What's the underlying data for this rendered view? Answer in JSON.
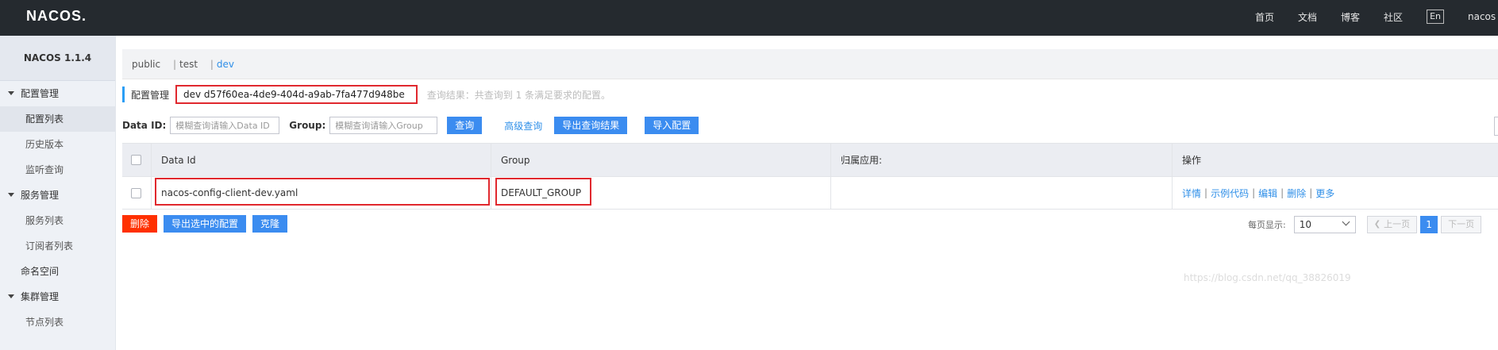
{
  "topbar": {
    "logo": "NACOS.",
    "nav": [
      "首页",
      "文档",
      "博客",
      "社区"
    ],
    "lang": "En",
    "user": "nacos"
  },
  "sidebar": {
    "version": "NACOS 1.1.4",
    "groups": [
      {
        "label": "配置管理",
        "items": [
          "配置列表",
          "历史版本",
          "监听查询"
        ]
      },
      {
        "label": "服务管理",
        "items": [
          "服务列表",
          "订阅者列表"
        ]
      }
    ],
    "namespace_label": "命名空间",
    "cluster": {
      "label": "集群管理",
      "items": [
        "节点列表"
      ]
    }
  },
  "namespaces": {
    "items": [
      "public",
      "test",
      "dev"
    ],
    "active": "dev",
    "separator": "|"
  },
  "page": {
    "title": "配置管理",
    "namespace_id": "dev  d57f60ea-4de9-404d-a9ab-7fa477d948be",
    "query_result": "查询结果：共查询到 1 条满足要求的配置。"
  },
  "filters": {
    "data_id_label": "Data ID:",
    "data_id_placeholder": "模糊查询请输入Data ID",
    "group_label": "Group:",
    "group_placeholder": "模糊查询请输入Group",
    "search_button": "查询",
    "advanced_link": "高级查询",
    "export_result_button": "导出查询结果",
    "import_button": "导入配置"
  },
  "table": {
    "columns": [
      "Data Id",
      "Group",
      "归属应用:",
      "操作"
    ],
    "rows": [
      {
        "data_id": "nacos-config-client-dev.yaml",
        "group": "DEFAULT_GROUP",
        "app": "",
        "actions": [
          "详情",
          "示例代码",
          "编辑",
          "删除",
          "更多"
        ]
      }
    ]
  },
  "bulk_actions": {
    "delete": "删除",
    "export_selected": "导出选中的配置",
    "clone": "克隆"
  },
  "pagination": {
    "page_size_label": "每页显示:",
    "page_size": "10",
    "prev": "上一页",
    "current": "1",
    "next": "下一页"
  },
  "watermark": "https://blog.csdn.net/qq_38826019",
  "colors": {
    "topbar": "#252a2f",
    "accent": "#3b8cf0",
    "danger": "#ff3000",
    "highlight": "#e0282e"
  }
}
